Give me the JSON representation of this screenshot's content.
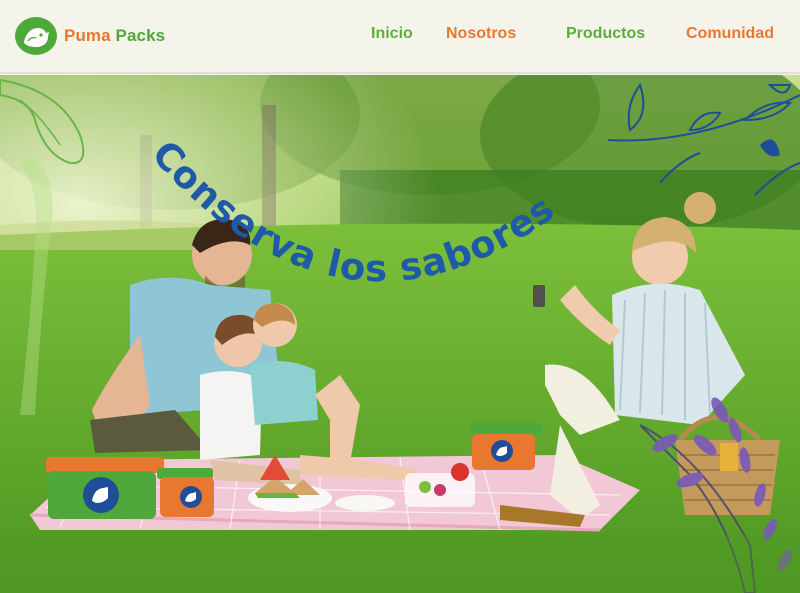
{
  "brand": {
    "name_part1": "Puma",
    "name_part2": "Packs"
  },
  "nav": {
    "items": [
      {
        "label": "Inicio"
      },
      {
        "label": "Nosotros"
      },
      {
        "label": "Productos"
      },
      {
        "label": "Comunidad"
      }
    ]
  },
  "hero": {
    "headline": "Conserva los sabores"
  },
  "colors": {
    "green": "#4fa83a",
    "orange": "#e87730",
    "navy": "#1f4e96",
    "header_bg": "#f5f4eb"
  },
  "icons": [
    "puma-logo-icon",
    "leaf-branch-decoration",
    "lavender-decoration"
  ]
}
